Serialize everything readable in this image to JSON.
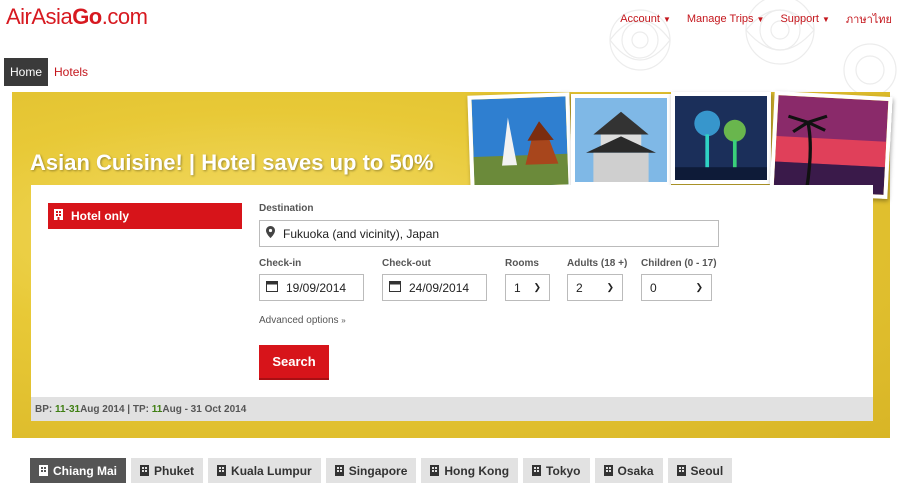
{
  "brand": {
    "logo_part1": "AirAsia",
    "logo_part2": "Go",
    "logo_part3": ".com",
    "color": "#d71920"
  },
  "top_nav": [
    {
      "label": "Account",
      "icon": "chevron-down-icon"
    },
    {
      "label": "Manage Trips",
      "icon": "chevron-down-icon"
    },
    {
      "label": "Support",
      "icon": "chevron-down-icon"
    },
    {
      "label": "ภาษาไทย"
    }
  ],
  "main_nav": {
    "home": "Home",
    "hotels": "Hotels"
  },
  "hero": {
    "title": "Asian Cuisine! | Hotel saves up to 50%"
  },
  "search": {
    "tab_label": "Hotel only",
    "destination_label": "Destination",
    "destination_value": "Fukuoka (and vicinity), Japan",
    "checkin_label": "Check-in",
    "checkin_value": "19/09/2014",
    "checkout_label": "Check-out",
    "checkout_value": "24/09/2014",
    "rooms_label": "Rooms",
    "rooms_value": "1",
    "adults_label": "Adults (18 +)",
    "adults_value": "2",
    "children_label": "Children (0 - 17)",
    "children_value": "0",
    "advanced_label": "Advanced options",
    "search_button": "Search"
  },
  "booking_period": {
    "bp_prefix": "BP: ",
    "bp_start": "11",
    "bp_sep": " - ",
    "bp_end": "31",
    "bp_suffix": " Aug 2014 | TP: ",
    "tp_start": "11",
    "tp_rest": " Aug - 31 Oct 2014"
  },
  "cities": [
    {
      "label": "Chiang Mai",
      "active": true
    },
    {
      "label": "Phuket"
    },
    {
      "label": "Kuala Lumpur"
    },
    {
      "label": "Singapore"
    },
    {
      "label": "Hong Kong"
    },
    {
      "label": "Tokyo"
    },
    {
      "label": "Osaka"
    },
    {
      "label": "Seoul"
    }
  ],
  "colors": {
    "accent": "#d7141a",
    "hero_yellow": "#e8c937",
    "active_tab": "#555555"
  }
}
